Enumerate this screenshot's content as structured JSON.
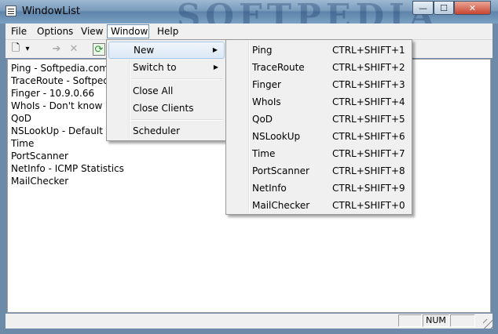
{
  "window": {
    "title": "WindowList",
    "watermark": "SOFTPEDIA"
  },
  "caption": {
    "minimize": "—",
    "maximize": "☐",
    "close": "✕"
  },
  "menubar": [
    "File",
    "Options",
    "View",
    "Window",
    "Help"
  ],
  "toolbar": {
    "new": "🗋",
    "dropdown": "▾",
    "go": "➔",
    "cancel": "✕",
    "refresh": "⟳"
  },
  "list": [
    "Ping - Softpedia.com",
    "TraceRoute - Softpedia.com",
    "Finger - 10.9.0.66",
    "WhoIs - Don't know",
    "QoD",
    "NSLookUp - Default DNS",
    "Time",
    "PortScanner",
    "NetInfo - ICMP Statistics",
    "MailChecker"
  ],
  "window_menu": {
    "new": "New",
    "switch_to": "Switch to",
    "close_all": "Close All",
    "close_clients": "Close Clients",
    "scheduler": "Scheduler",
    "arrow": "▶"
  },
  "new_submenu": [
    {
      "label": "Ping",
      "shortcut": "CTRL+SHIFT+1"
    },
    {
      "label": "TraceRoute",
      "shortcut": "CTRL+SHIFT+2"
    },
    {
      "label": "Finger",
      "shortcut": "CTRL+SHIFT+3"
    },
    {
      "label": "WhoIs",
      "shortcut": "CTRL+SHIFT+4"
    },
    {
      "label": "QoD",
      "shortcut": "CTRL+SHIFT+5"
    },
    {
      "label": "NSLookUp",
      "shortcut": "CTRL+SHIFT+6"
    },
    {
      "label": "Time",
      "shortcut": "CTRL+SHIFT+7"
    },
    {
      "label": "PortScanner",
      "shortcut": "CTRL+SHIFT+8"
    },
    {
      "label": "NetInfo",
      "shortcut": "CTRL+SHIFT+9"
    },
    {
      "label": "MailChecker",
      "shortcut": "CTRL+SHIFT+0"
    }
  ],
  "statusbar": {
    "num": "NUM"
  }
}
